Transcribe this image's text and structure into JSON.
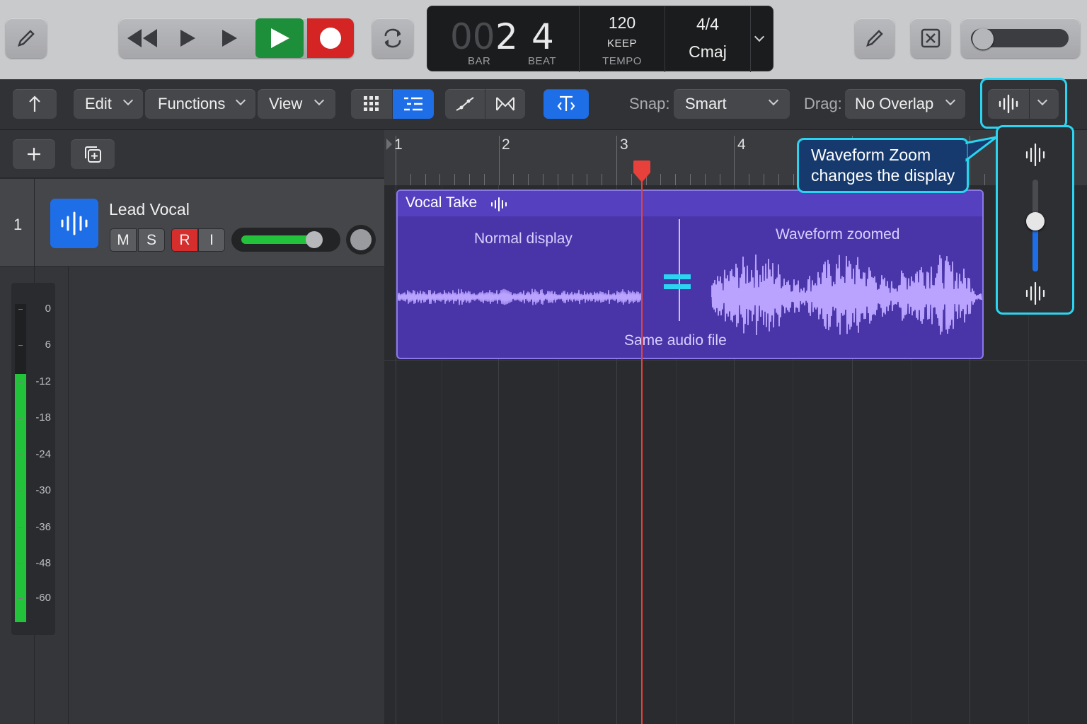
{
  "lcd": {
    "bar_prefix": "00",
    "bar": "2",
    "beat": "4",
    "bar_label": "BAR",
    "beat_label": "BEAT",
    "tempo": "120",
    "tempo_mode": "KEEP",
    "tempo_label": "TEMPO",
    "signature": "4/4",
    "key": "Cmaj"
  },
  "toolbar": {
    "edit": "Edit",
    "functions": "Functions",
    "view": "View",
    "snap_label": "Snap:",
    "snap_value": "Smart",
    "drag_label": "Drag:",
    "drag_value": "No Overlap"
  },
  "track": {
    "number": "1",
    "name": "Lead Vocal",
    "mute": "M",
    "solo": "S",
    "record": "R",
    "input": "I",
    "volume_fraction": 0.8
  },
  "meter_scale": [
    "0",
    "6",
    "-12",
    "-18",
    "-24",
    "-30",
    "-36",
    "-48",
    "-60"
  ],
  "meter_level_fraction": 0.78,
  "ruler": [
    "1",
    "2",
    "3",
    "4"
  ],
  "region": {
    "name": "Vocal Take",
    "left_label": "Normal display",
    "right_label": "Waveform zoomed",
    "bottom_label": "Same audio file",
    "equals": "="
  },
  "callout": {
    "text_line1": "Waveform Zoom",
    "text_line2": "changes the display"
  },
  "waveform_zoom_fraction": 0.55,
  "colors": {
    "accent": "#1e6ee8",
    "play": "#1d8f3a",
    "record": "#d42424",
    "region": "#4a35a8",
    "waveform": "#b9a3ff",
    "playhead": "#e8403a",
    "callout": "#2bd4f0",
    "meter": "#22c33a"
  }
}
